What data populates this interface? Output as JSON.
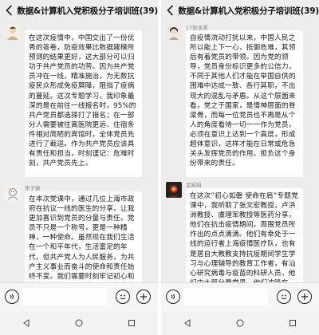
{
  "left": {
    "title": "数据&计算机入党积极分子培训班(39)",
    "messages": [
      {
        "nick": "",
        "text": "在这次疫情中，中国交出了一份优秀的答卷，防疫效果比数据建模所预测的结果更好，这大部分可以归功于共产党员的功劳。因为共产党员冲在一线，精准施治，为无数抗疫民众形成免疫屏障，阻挡了疫病的蔓延。这次专题学习，我印象最深的是在前往一线报名时，95%的共产党员都选择打了报名；在一部分人需要被往离医院更远、住宿条件相对简陋的宾馆时，全体党员先进行了截逗。作为共产党员应该具有责任和担当，时刻谨记：危难时刻，共产党员先上。"
      },
      {
        "nick": "朱子豪",
        "text": "在本次党课中，通过几位上海市政府在抗议一线的医生的分享，让我更加喜识到党员的分量与责任。党员不只是一个称号，更是一种精神，一种使命。虽然现在我们生活在一个和平年代，生活富足的年代，但共产党人为人民服务，为共产主义事业而奋斗的使命和责任始终不变。我们需要时刻牢记初心和使命，在人民和国家需要我们的时候挺身而出，贡献力量！"
      }
    ]
  },
  "right": {
    "title": "数据&计算机入党积极分子培训班(39)",
    "messages": [
      {
        "nick": "17智多美",
        "text": "自疫情流动打扰以来，中国人民之所以能上下一心，抵御危难，其领后有着党员的带领。因为党的领导，党员身份标识更多的公信力，不同于其他人们才能在举国自供的困难中达成一致、各行其职，不出现大的混乱与矛盾。从这个层面来看，党之于国家，是情神层面的脊梁骨，而每一位党员也不再是从个人的角度看待一切一一作为党员，必须在意识上达到一个高度，形成超体意识，这样才能在日常或危急关头发挥党员的作用，担负这个身份带来的责任。"
      },
      {
        "nick": "孟娟娟",
        "text": "在这次”初心如磐 使命在肩”专题党课中，我听取了张文宏教授，卢洪洲教授、虞理军教授等医药分享，他们在抗击疫情期间，周围党员所作出的点点滴滴。他们有幸处于一线的运行者上海疫情医疗队，也有是居自大教教支持抗疫期间学生学习与心理辅导的教育工作者，有汕心研究病毒与疫苗的科研人员，他们中大部分是党员，他们冲锋在前，期间中有众多部分入党员以"
      }
    ]
  },
  "input_icons": {
    "voice": "voice-icon",
    "emoji": "emoji-icon",
    "plus": "plus-icon"
  }
}
